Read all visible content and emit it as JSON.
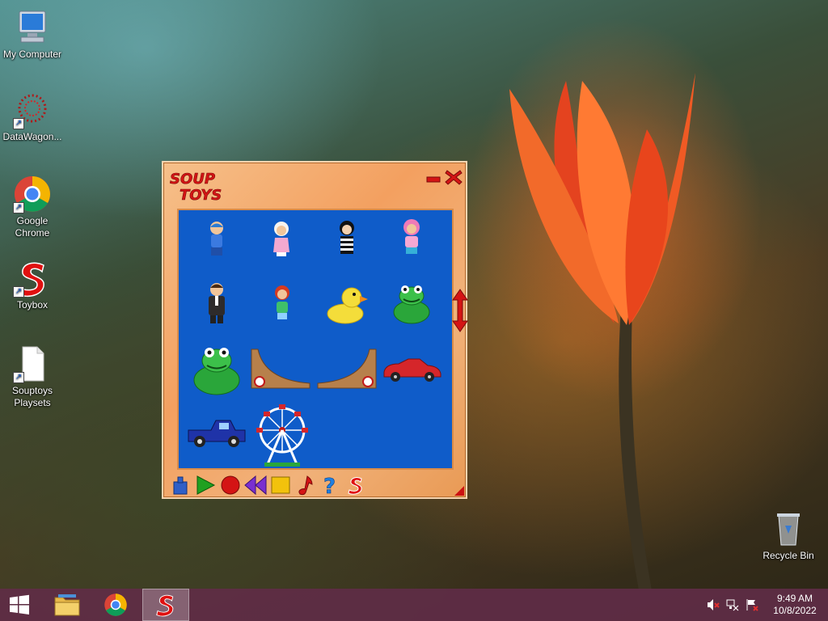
{
  "desktop": {
    "icons": [
      {
        "label": "My Computer",
        "icon": "computer-icon"
      },
      {
        "label": "DataWagon...",
        "icon": "datawagon-icon"
      },
      {
        "label": "Google Chrome",
        "icon": "chrome-icon"
      },
      {
        "label": "Toybox",
        "icon": "souptoys-s-icon"
      },
      {
        "label": "Souptoys Playsets",
        "icon": "document-icon"
      },
      {
        "label": "Recycle Bin",
        "icon": "recycle-bin-icon"
      }
    ]
  },
  "app": {
    "logo_line1": "SOUP",
    "logo_line2": "TOYS",
    "toys": [
      "doll-blue-figure",
      "doll-white-hair-figure",
      "doll-striped-figure",
      "doll-pink-hair-figure",
      "man-in-suit-figure",
      "doll-red-hair-figure",
      "rubber-duck",
      "frog-small",
      "frog-large",
      "skate-ramp-left",
      "skate-ramp-right",
      "red-sports-car",
      "blue-pickup-truck",
      "ferris-wheel"
    ],
    "toolbar": [
      "weight-tool",
      "play-tool",
      "record-tool",
      "rewind-tool",
      "stop-tool",
      "music-tool",
      "help-tool",
      "souptoys-tool"
    ]
  },
  "taskbar": {
    "apps": [
      "start-icon",
      "file-explorer-icon",
      "chrome-icon",
      "souptoys-s-icon"
    ],
    "time": "9:49 AM",
    "date": "10/8/2022"
  },
  "colors": {
    "accent": "#cc1111",
    "playfield": "#0f5cc9",
    "taskbar": "#5f2d46"
  }
}
